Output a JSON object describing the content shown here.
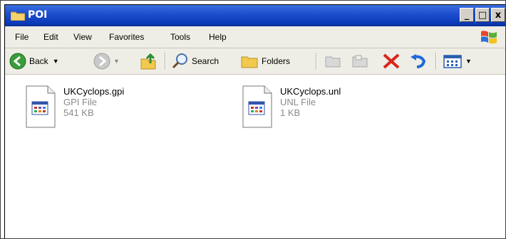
{
  "window": {
    "title": "POI",
    "minimize": "_",
    "maximize": "□",
    "close": "x"
  },
  "menu": [
    "File",
    "Edit",
    "View",
    "Favorites",
    "Tools",
    "Help"
  ],
  "toolbar": {
    "back_label": "Back",
    "search_label": "Search",
    "folders_label": "Folders"
  },
  "files": [
    {
      "name": "UKCyclops.gpi",
      "type": "GPI File",
      "size": "541 KB"
    },
    {
      "name": "UKCyclops.unl",
      "type": "UNL File",
      "size": "1 KB"
    }
  ],
  "colors": {
    "titlebar": "#1f4fcf",
    "close_red": "#d8261b",
    "folder_yellow": "#f2c94c"
  }
}
